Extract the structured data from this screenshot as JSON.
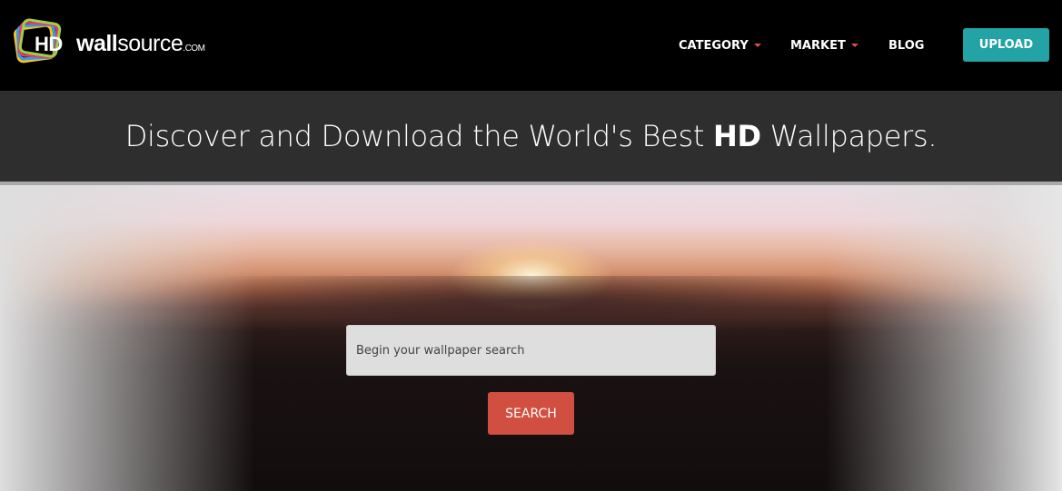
{
  "brand": {
    "logo_hd": "HD",
    "logo_wall": "wall",
    "logo_source": "source",
    "logo_com": ".COM"
  },
  "nav": {
    "items": [
      {
        "label": "CATEGORY",
        "has_dropdown": true
      },
      {
        "label": "MARKET",
        "has_dropdown": true
      },
      {
        "label": "BLOG",
        "has_dropdown": false
      }
    ],
    "upload_label": "UPLOAD"
  },
  "tagline": {
    "before": "Discover and Download the World's Best ",
    "highlight": "HD",
    "after": " Wallpapers."
  },
  "search": {
    "placeholder": "Begin your wallpaper search",
    "button_label": "SEARCH"
  },
  "colors": {
    "accent_teal": "#23a3a5",
    "accent_red": "#d14f40",
    "caret_red": "#e04a4a"
  },
  "icons": {
    "logo": "hd-wallsource-logo-icon",
    "dropdown": "caret-down-icon"
  }
}
